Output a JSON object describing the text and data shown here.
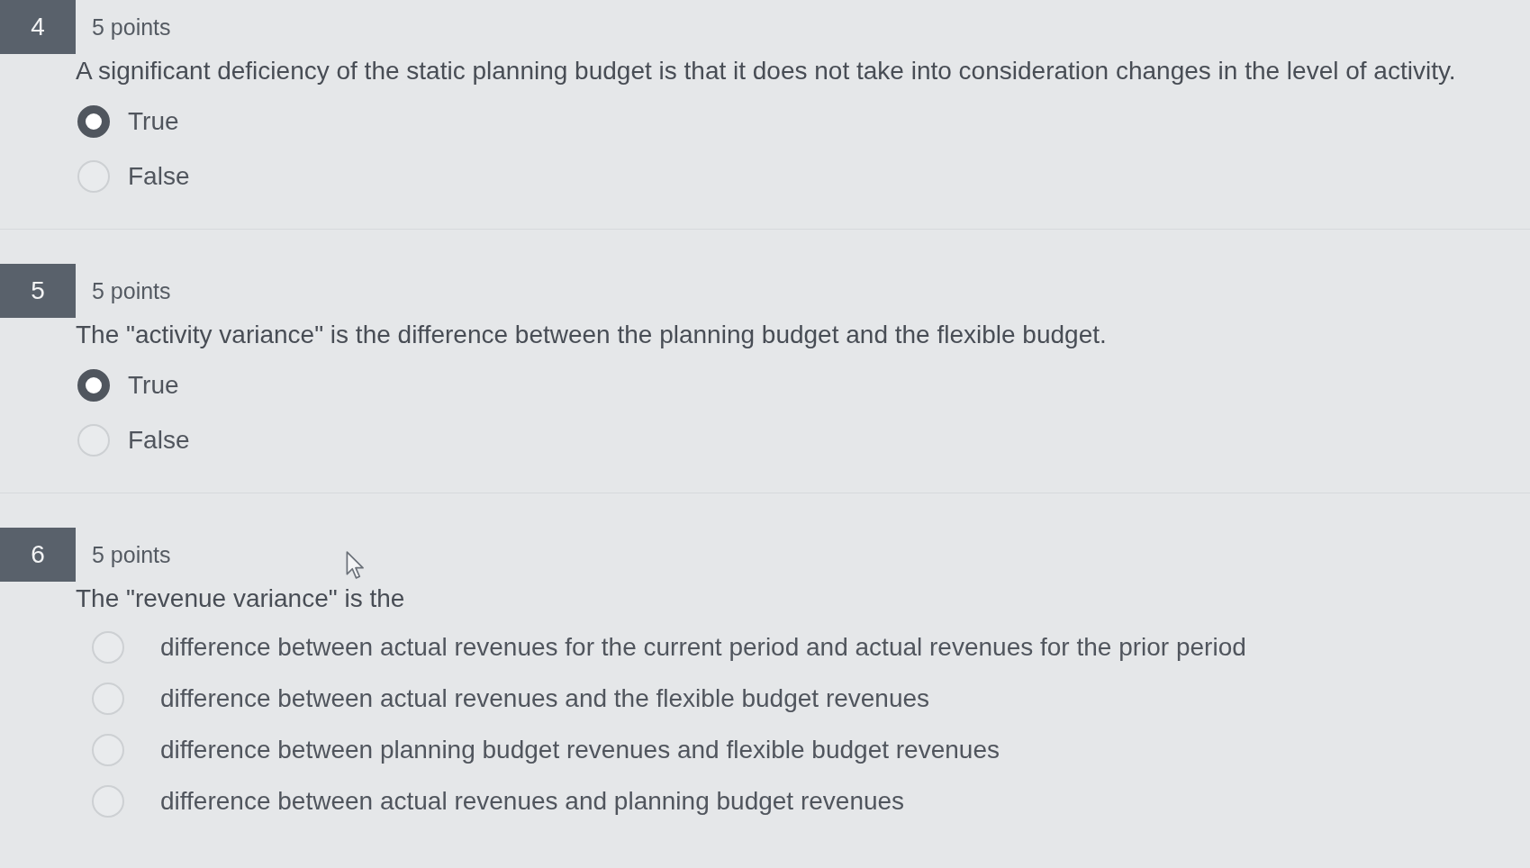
{
  "questions": [
    {
      "number": "4",
      "points": "5 points",
      "kind": "true_false",
      "prompt": "A significant deficiency of the static planning budget is that it does not take into consideration changes in the level of activity.",
      "options": [
        {
          "label": "True",
          "selected": true
        },
        {
          "label": "False",
          "selected": false
        }
      ]
    },
    {
      "number": "5",
      "points": "5 points",
      "kind": "true_false",
      "prompt": "The \"activity variance\" is the difference between the planning budget and the flexible budget.",
      "options": [
        {
          "label": "True",
          "selected": true
        },
        {
          "label": "False",
          "selected": false
        }
      ]
    },
    {
      "number": "6",
      "points": "5 points",
      "kind": "multiple_choice",
      "prompt": "The \"revenue variance\" is the",
      "options": [
        {
          "label": "difference between actual revenues for the current period and actual revenues for the prior period",
          "selected": false
        },
        {
          "label": "difference between actual revenues and the flexible budget revenues",
          "selected": false
        },
        {
          "label": "difference between planning budget revenues and flexible budget revenues",
          "selected": false
        },
        {
          "label": "difference between actual revenues and planning budget revenues",
          "selected": false
        }
      ]
    }
  ]
}
